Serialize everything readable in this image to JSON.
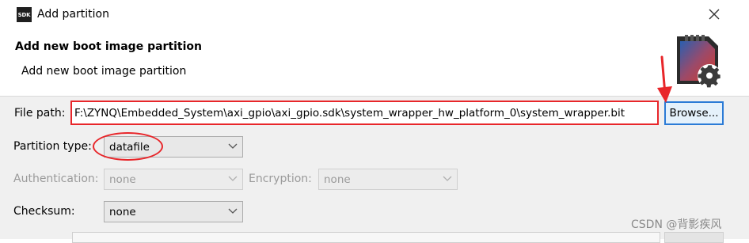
{
  "window": {
    "app_icon_text": "SDK",
    "title": "Add partition"
  },
  "header": {
    "title": "Add new boot image partition",
    "description": "Add new boot image partition"
  },
  "form": {
    "file_path_label": "File path:",
    "file_path_value": "F:\\ZYNQ\\Embedded_System\\axi_gpio\\axi_gpio.sdk\\system_wrapper_hw_platform_0\\system_wrapper.bit",
    "browse_label": "Browse...",
    "partition_type_label": "Partition type:",
    "partition_type_value": "datafile",
    "authentication_label": "Authentication:",
    "authentication_value": "none",
    "encryption_label": "Encryption:",
    "encryption_value": "none",
    "checksum_label": "Checksum:",
    "checksum_value": "none"
  },
  "watermark": "CSDN @背影疾风",
  "colors": {
    "annotation_red": "#e8262a",
    "focus_blue": "#2b7bd6"
  }
}
